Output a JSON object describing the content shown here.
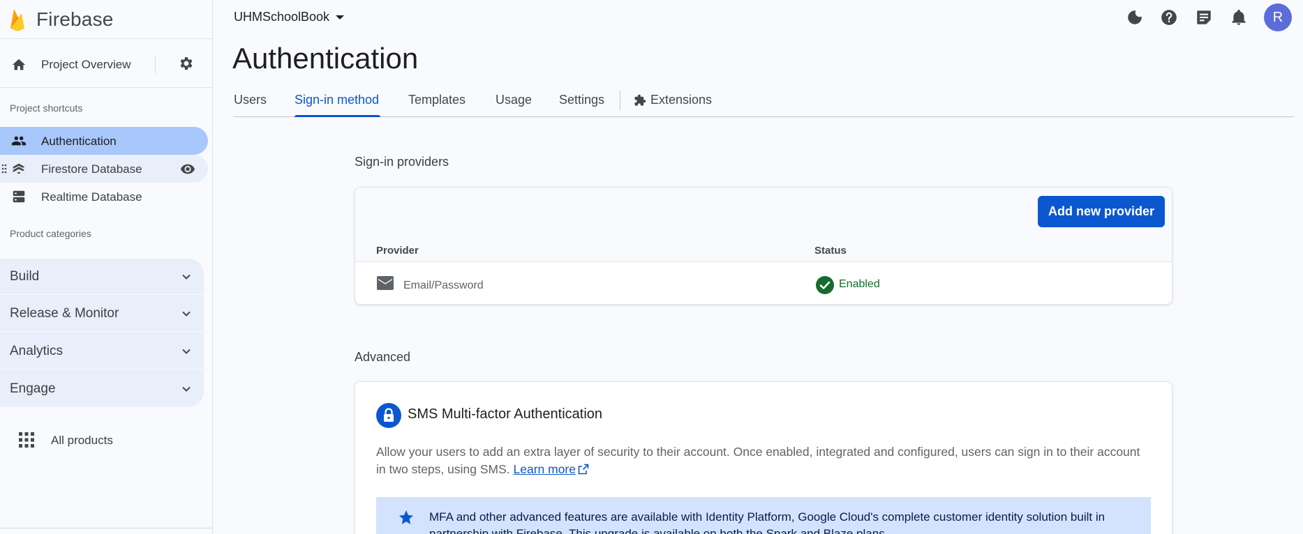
{
  "app": {
    "name": "Firebase"
  },
  "sidebar": {
    "overview_label": "Project Overview",
    "shortcuts_label": "Project shortcuts",
    "shortcuts": [
      {
        "label": "Authentication"
      },
      {
        "label": "Firestore Database"
      },
      {
        "label": "Realtime Database"
      }
    ],
    "categories_label": "Product categories",
    "categories": [
      {
        "label": "Build"
      },
      {
        "label": "Release & Monitor"
      },
      {
        "label": "Analytics"
      },
      {
        "label": "Engage"
      }
    ],
    "all_products_label": "All products"
  },
  "topbar": {
    "project_name": "UHMSchoolBook",
    "avatar_initial": "R"
  },
  "page": {
    "title": "Authentication"
  },
  "tabs": [
    {
      "label": "Users"
    },
    {
      "label": "Sign-in method"
    },
    {
      "label": "Templates"
    },
    {
      "label": "Usage"
    },
    {
      "label": "Settings"
    },
    {
      "label": "Extensions"
    }
  ],
  "providers": {
    "section_label": "Sign-in providers",
    "add_button": "Add new provider",
    "columns": {
      "provider": "Provider",
      "status": "Status"
    },
    "rows": [
      {
        "name": "Email/Password",
        "status": "Enabled"
      }
    ]
  },
  "advanced": {
    "section_label": "Advanced",
    "mfa_title": "SMS Multi-factor Authentication",
    "mfa_desc": "Allow your users to add an extra layer of security to their account. Once enabled, integrated and configured, users can sign in to their account in two steps, using SMS.",
    "learn_more": "Learn more",
    "banner_text": "MFA and other advanced features are available with Identity Platform, Google Cloud's complete customer identity solution built in partnership with Firebase. This upgrade is available on both the Spark and Blaze plans."
  },
  "colors": {
    "accent": "#0b57d0",
    "active_nav": "#a8c7fa",
    "enabled_green": "#146c2e",
    "banner_bg": "#d3e3fd"
  }
}
